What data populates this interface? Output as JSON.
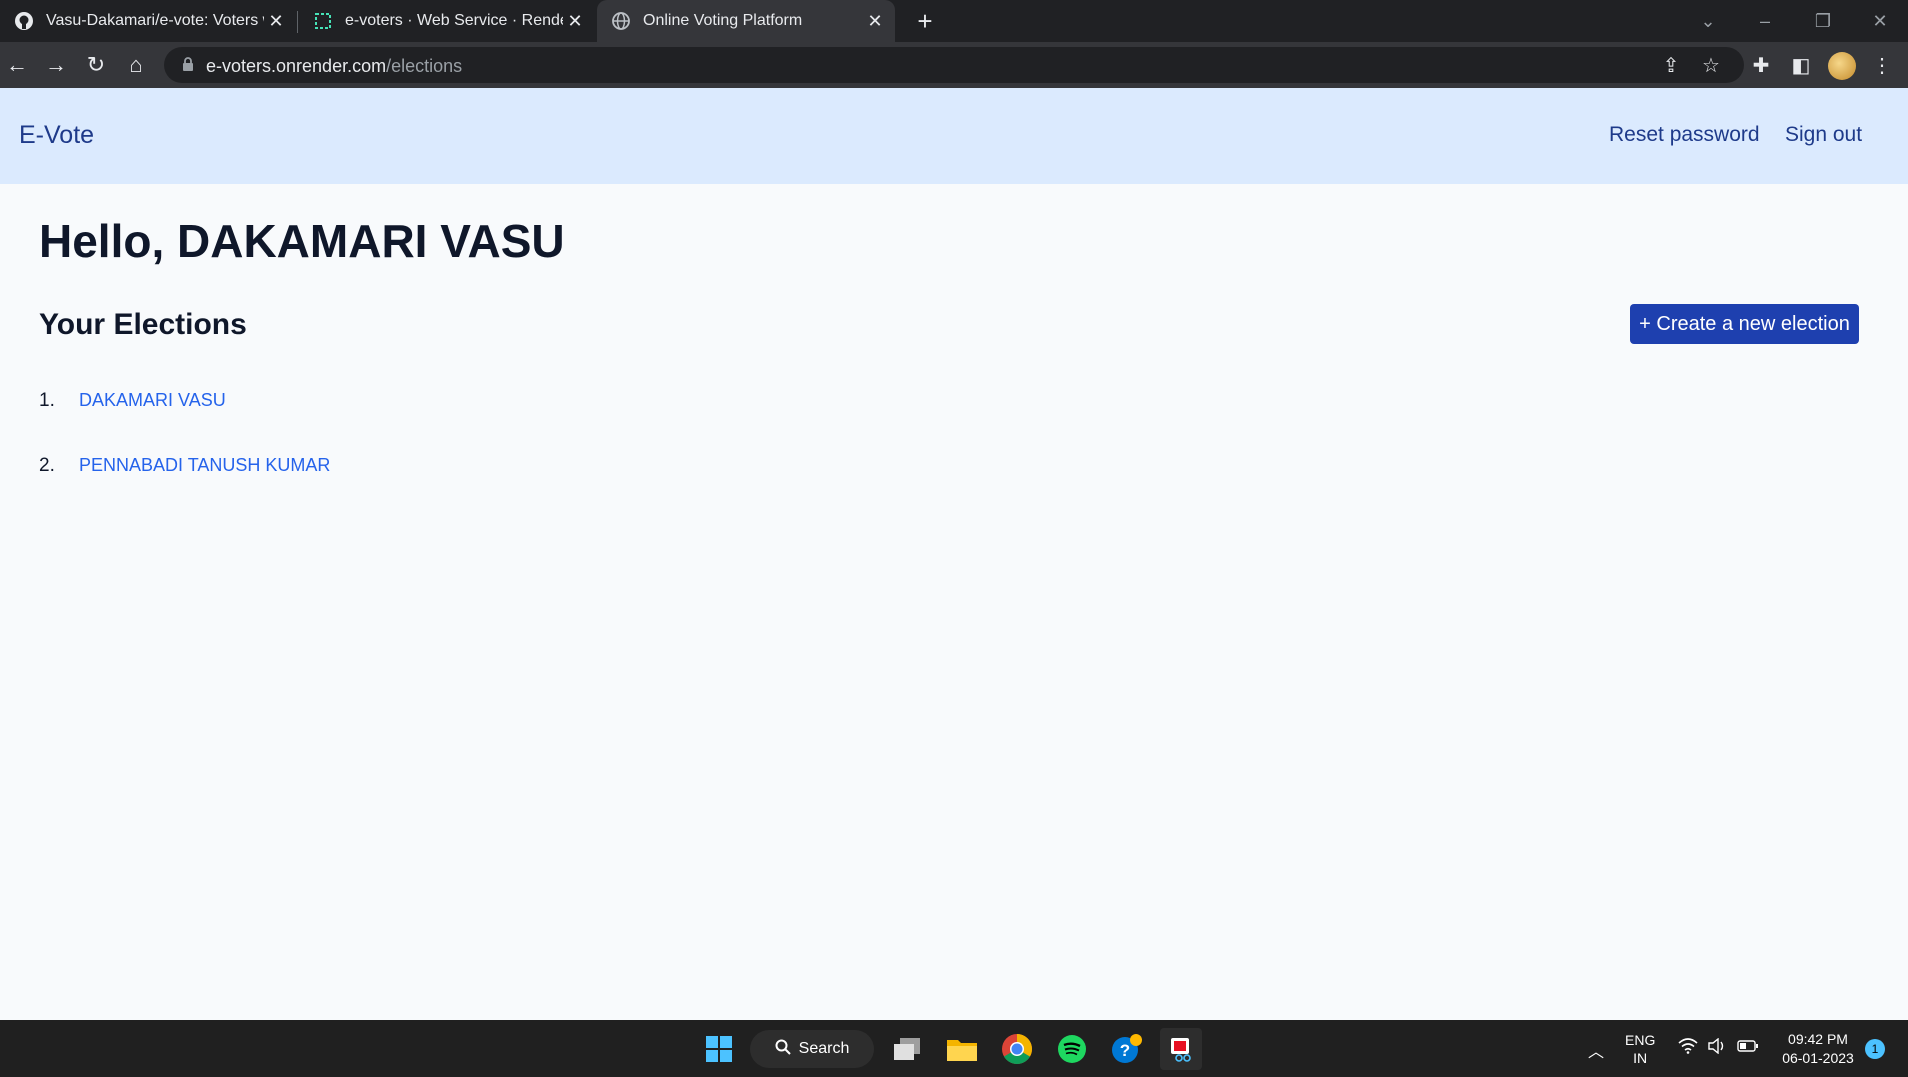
{
  "browser": {
    "tabs": [
      {
        "title": "Vasu-Dakamari/e-vote: Voters we",
        "favicon": "github-icon"
      },
      {
        "title": "e-voters · Web Service · Render",
        "favicon": "render-icon"
      },
      {
        "title": "Online Voting Platform",
        "favicon": "globe-icon"
      }
    ],
    "url_host": "e-voters.onrender.com",
    "url_path": "/elections"
  },
  "app": {
    "brand": "E-Vote",
    "nav": {
      "reset_password": "Reset password",
      "sign_out": "Sign out"
    },
    "greeting": "Hello, DAKAMARI VASU",
    "section_title": "Your Elections",
    "create_button": "+ Create a new election",
    "elections": [
      {
        "number": "1.",
        "name": "DAKAMARI VASU"
      },
      {
        "number": "2.",
        "name": "PENNABADI TANUSH KUMAR"
      }
    ],
    "colors": {
      "navbar_bg": "#dbeafe",
      "brand": "#1e3a8a",
      "button_bg": "#1e40af",
      "link": "#2563eb"
    }
  },
  "taskbar": {
    "search_label": "Search",
    "language": "ENG",
    "region": "IN",
    "time": "09:42 PM",
    "date": "06-01-2023",
    "notification_count": "1"
  }
}
